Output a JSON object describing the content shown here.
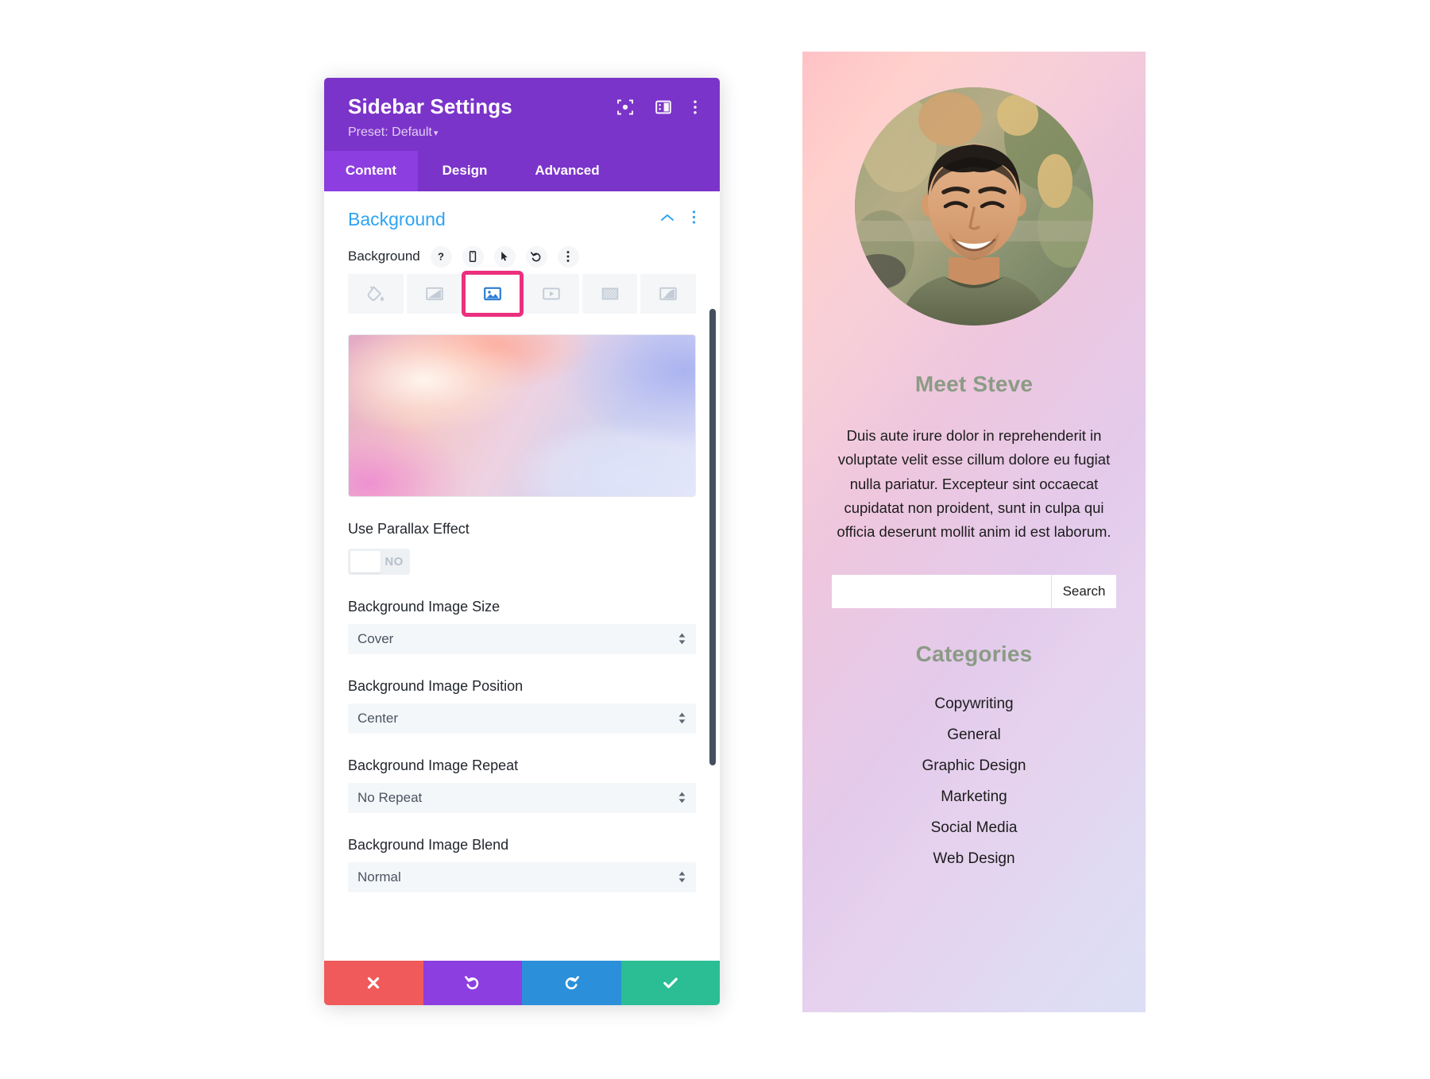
{
  "modal": {
    "title": "Sidebar Settings",
    "preset": "Preset: Default",
    "preset_caret": "▾",
    "header_icons": [
      {
        "name": "focus-icon"
      },
      {
        "name": "layout-panel-icon"
      },
      {
        "name": "more-options-icon"
      }
    ],
    "tabs": [
      {
        "label": "Content",
        "active": true
      },
      {
        "label": "Design",
        "active": false
      },
      {
        "label": "Advanced",
        "active": false
      }
    ],
    "section": {
      "title": "Background",
      "collapse_icon": "chevron-up-icon",
      "options_icon": "more-options-icon"
    },
    "background_field": {
      "label": "Background",
      "mini_icons": [
        "help-icon",
        "responsive-mobile-icon",
        "hover-cursor-icon",
        "reset-icon",
        "more-options-icon"
      ],
      "types": [
        {
          "name": "background-color",
          "icon": "paint-bucket-icon",
          "selected": false
        },
        {
          "name": "background-gradient",
          "icon": "gradient-icon",
          "selected": false
        },
        {
          "name": "background-image",
          "icon": "image-icon",
          "selected": true
        },
        {
          "name": "background-video",
          "icon": "video-icon",
          "selected": false
        },
        {
          "name": "background-pattern",
          "icon": "pattern-icon",
          "selected": false
        },
        {
          "name": "background-mask",
          "icon": "mask-icon",
          "selected": false
        }
      ],
      "highlight_color": "#ec2f7e",
      "active_icon_color": "#2b7bd4"
    },
    "parallax": {
      "label": "Use Parallax Effect",
      "toggle_value": "NO"
    },
    "selects": [
      {
        "label": "Background Image Size",
        "value": "Cover"
      },
      {
        "label": "Background Image Position",
        "value": "Center"
      },
      {
        "label": "Background Image Repeat",
        "value": "No Repeat"
      },
      {
        "label": "Background Image Blend",
        "value": "Normal"
      }
    ],
    "footer": [
      {
        "name": "cancel-button",
        "icon": "close-icon",
        "color": "#f05a5a"
      },
      {
        "name": "undo-button",
        "icon": "undo-icon",
        "color": "#8c3ee0"
      },
      {
        "name": "redo-button",
        "icon": "redo-icon",
        "color": "#2b90d9"
      },
      {
        "name": "save-button",
        "icon": "checkmark-icon",
        "color": "#2bbd94"
      }
    ]
  },
  "preview": {
    "avatar_alt": "smiling-man-portrait",
    "heading": "Meet Steve",
    "body": "Duis aute irure dolor in reprehenderit in voluptate velit esse cillum dolore eu fugiat nulla pariatur. Excepteur sint occaecat cupidatat non proident, sunt in culpa qui officia deserunt mollit anim id est laborum.",
    "search": {
      "value": "",
      "placeholder": "",
      "button_label": "Search"
    },
    "categories_heading": "Categories",
    "categories": [
      "Copywriting",
      "General",
      "Graphic Design",
      "Marketing",
      "Social Media",
      "Web Design"
    ],
    "heading_color": "#8b9b85"
  }
}
